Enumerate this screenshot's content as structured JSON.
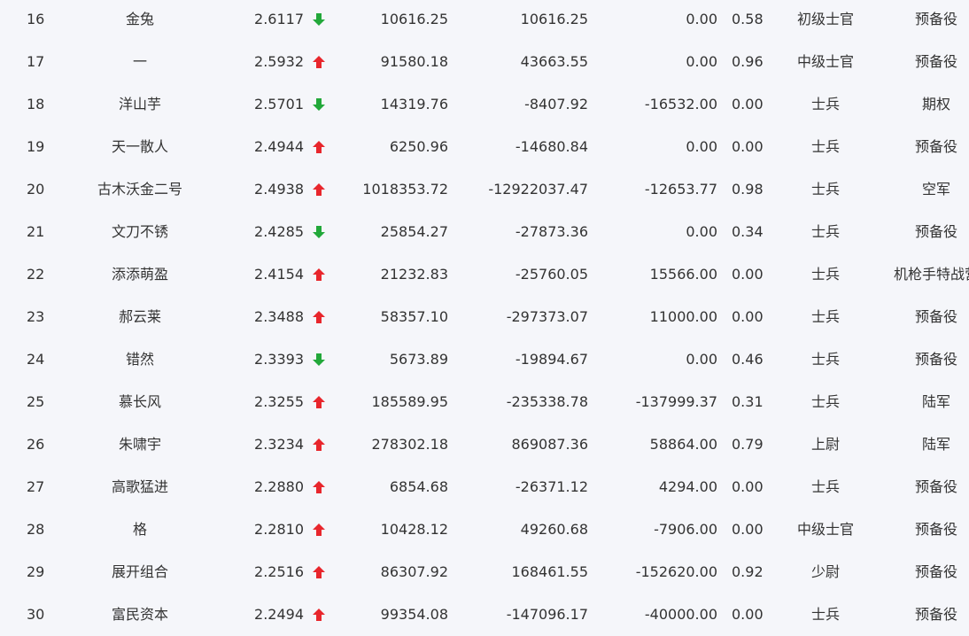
{
  "colors": {
    "up": "#e8262c",
    "down": "#22a83a",
    "text": "#333333",
    "background": "#f5f6fa"
  },
  "rows": [
    {
      "rank": "16",
      "name": "金兔",
      "score": "2.6117",
      "trend": "down",
      "v1": "10616.25",
      "v2": "10616.25",
      "v3": "0.00",
      "ratio": "0.58",
      "military_rank": "初级士官",
      "branch": "预备役"
    },
    {
      "rank": "17",
      "name": "一",
      "score": "2.5932",
      "trend": "up",
      "v1": "91580.18",
      "v2": "43663.55",
      "v3": "0.00",
      "ratio": "0.96",
      "military_rank": "中级士官",
      "branch": "预备役"
    },
    {
      "rank": "18",
      "name": "洋山芋",
      "score": "2.5701",
      "trend": "down",
      "v1": "14319.76",
      "v2": "-8407.92",
      "v3": "-16532.00",
      "ratio": "0.00",
      "military_rank": "士兵",
      "branch": "期权"
    },
    {
      "rank": "19",
      "name": "天一散人",
      "score": "2.4944",
      "trend": "up",
      "v1": "6250.96",
      "v2": "-14680.84",
      "v3": "0.00",
      "ratio": "0.00",
      "military_rank": "士兵",
      "branch": "预备役"
    },
    {
      "rank": "20",
      "name": "古木沃金二号",
      "score": "2.4938",
      "trend": "up",
      "v1": "1018353.72",
      "v2": "-12922037.47",
      "v3": "-12653.77",
      "ratio": "0.98",
      "military_rank": "士兵",
      "branch": "空军"
    },
    {
      "rank": "21",
      "name": "文刀不锈",
      "score": "2.4285",
      "trend": "down",
      "v1": "25854.27",
      "v2": "-27873.36",
      "v3": "0.00",
      "ratio": "0.34",
      "military_rank": "士兵",
      "branch": "预备役"
    },
    {
      "rank": "22",
      "name": "添添萌盈",
      "score": "2.4154",
      "trend": "up",
      "v1": "21232.83",
      "v2": "-25760.05",
      "v3": "15566.00",
      "ratio": "0.00",
      "military_rank": "士兵",
      "branch": "机枪手特战营"
    },
    {
      "rank": "23",
      "name": "郝云莱",
      "score": "2.3488",
      "trend": "up",
      "v1": "58357.10",
      "v2": "-297373.07",
      "v3": "11000.00",
      "ratio": "0.00",
      "military_rank": "士兵",
      "branch": "预备役"
    },
    {
      "rank": "24",
      "name": "错然",
      "score": "2.3393",
      "trend": "down",
      "v1": "5673.89",
      "v2": "-19894.67",
      "v3": "0.00",
      "ratio": "0.46",
      "military_rank": "士兵",
      "branch": "预备役"
    },
    {
      "rank": "25",
      "name": "慕长风",
      "score": "2.3255",
      "trend": "up",
      "v1": "185589.95",
      "v2": "-235338.78",
      "v3": "-137999.37",
      "ratio": "0.31",
      "military_rank": "士兵",
      "branch": "陆军"
    },
    {
      "rank": "26",
      "name": "朱啸宇",
      "score": "2.3234",
      "trend": "up",
      "v1": "278302.18",
      "v2": "869087.36",
      "v3": "58864.00",
      "ratio": "0.79",
      "military_rank": "上尉",
      "branch": "陆军"
    },
    {
      "rank": "27",
      "name": "高歌猛进",
      "score": "2.2880",
      "trend": "up",
      "v1": "6854.68",
      "v2": "-26371.12",
      "v3": "4294.00",
      "ratio": "0.00",
      "military_rank": "士兵",
      "branch": "预备役"
    },
    {
      "rank": "28",
      "name": "格",
      "score": "2.2810",
      "trend": "up",
      "v1": "10428.12",
      "v2": "49260.68",
      "v3": "-7906.00",
      "ratio": "0.00",
      "military_rank": "中级士官",
      "branch": "预备役"
    },
    {
      "rank": "29",
      "name": "展开组合",
      "score": "2.2516",
      "trend": "up",
      "v1": "86307.92",
      "v2": "168461.55",
      "v3": "-152620.00",
      "ratio": "0.92",
      "military_rank": "少尉",
      "branch": "预备役"
    },
    {
      "rank": "30",
      "name": "富民资本",
      "score": "2.2494",
      "trend": "up",
      "v1": "99354.08",
      "v2": "-147096.17",
      "v3": "-40000.00",
      "ratio": "0.00",
      "military_rank": "士兵",
      "branch": "预备役"
    }
  ]
}
